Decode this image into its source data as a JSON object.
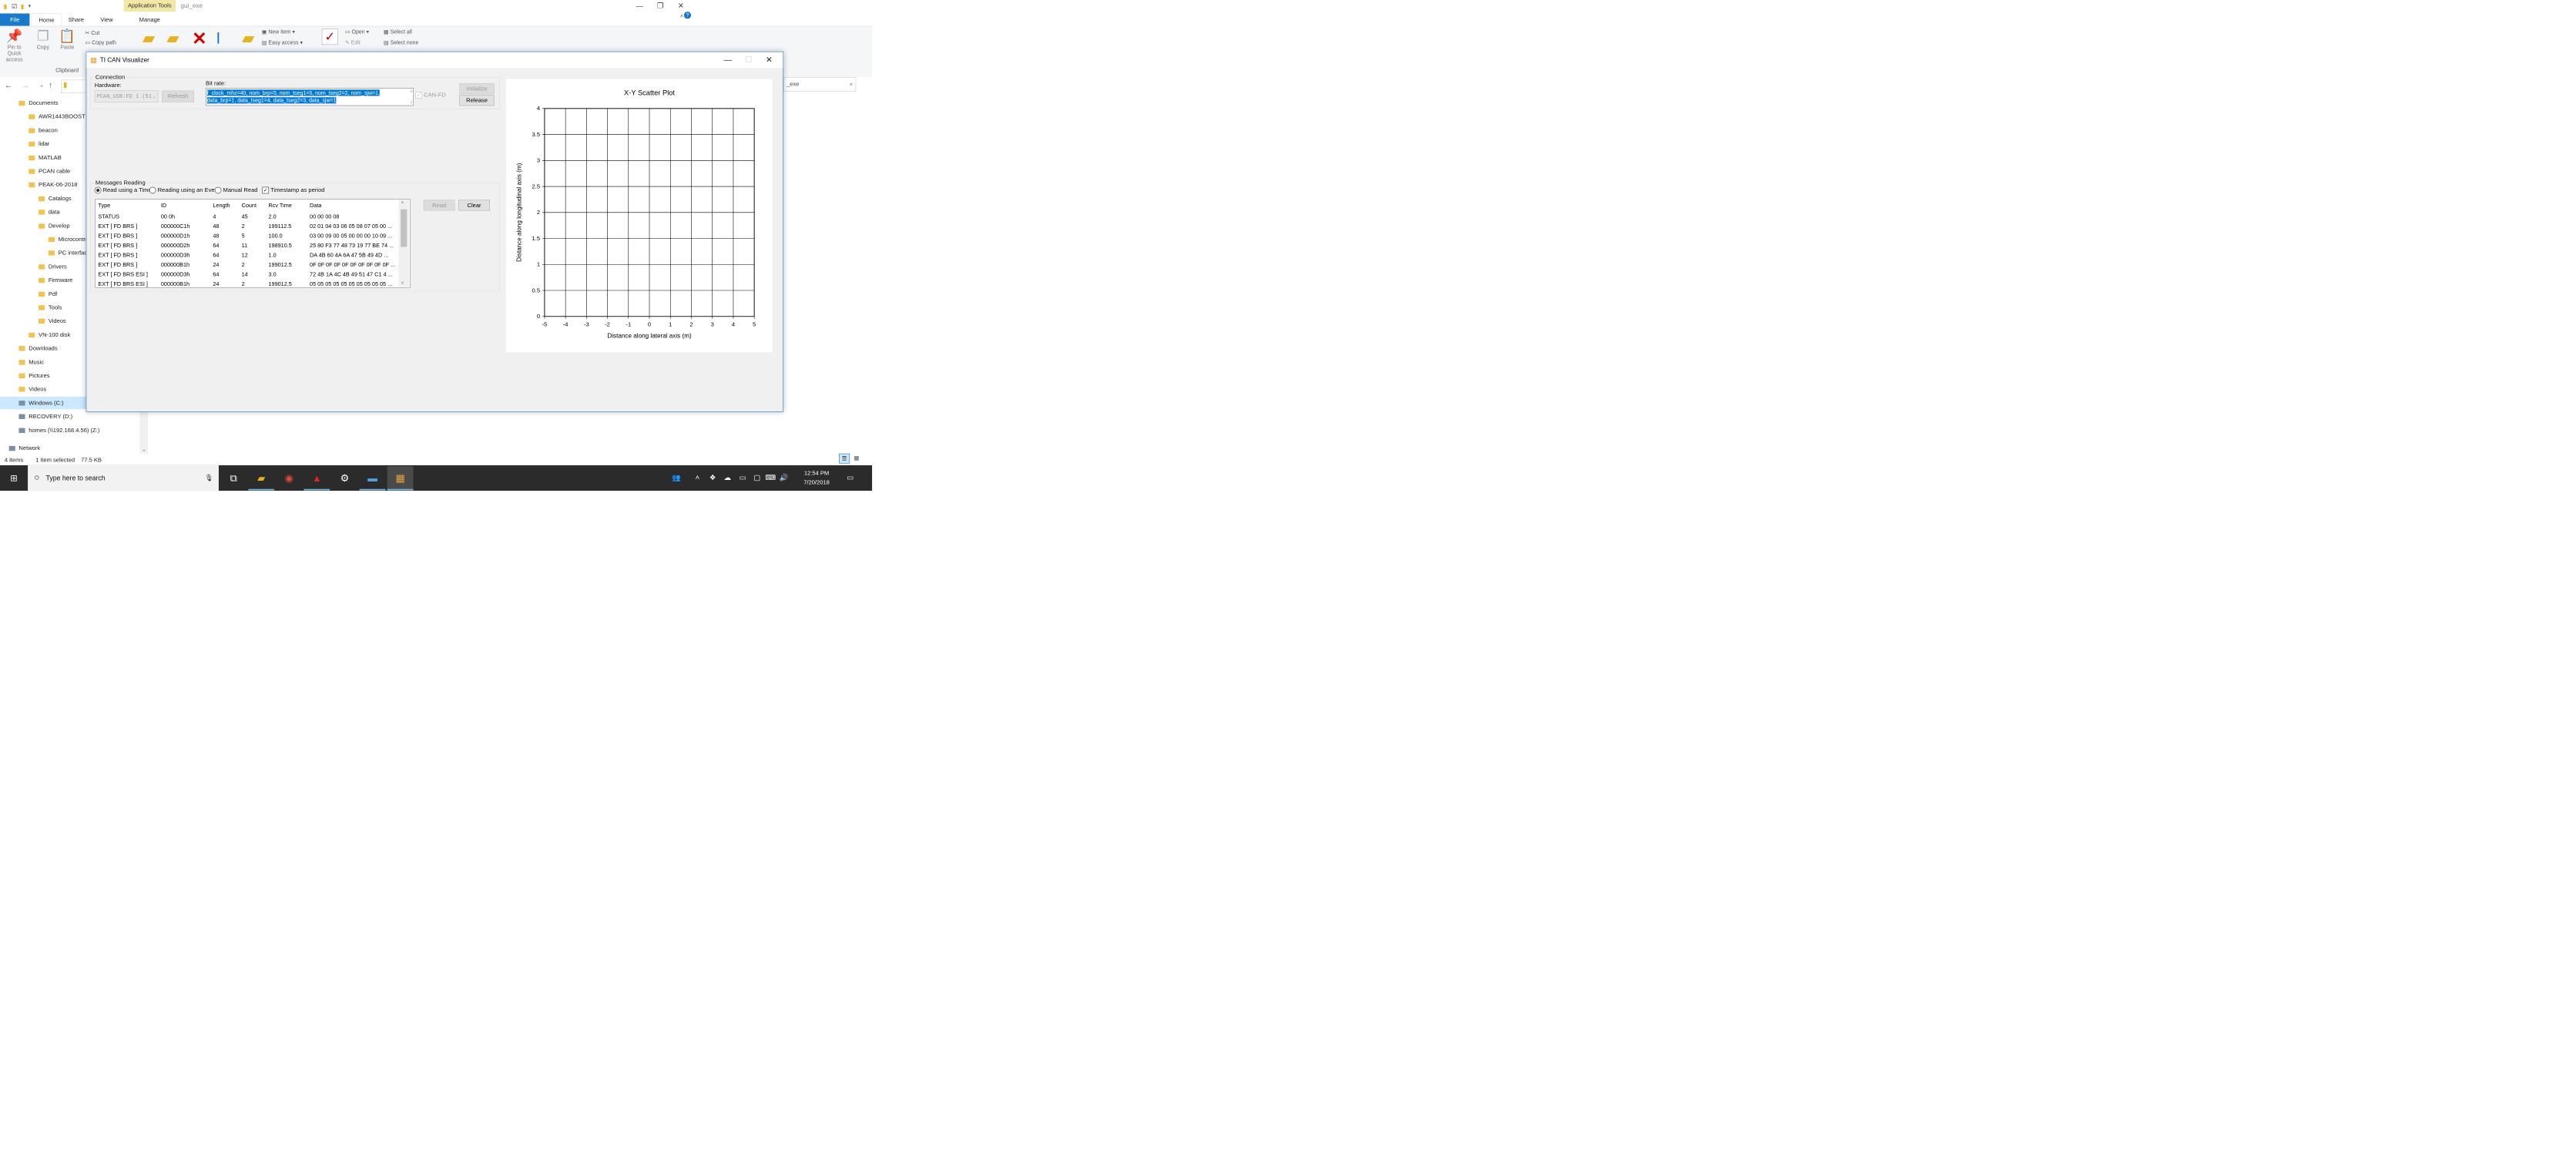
{
  "explorer": {
    "context_tab": "Application Tools",
    "window_title": "gui_exe",
    "ribbon_tabs": [
      "File",
      "Home",
      "Share",
      "View",
      "Manage"
    ],
    "ribbon": {
      "pin_label": "Pin to Quick access",
      "copy_label": "Copy",
      "paste_label": "Paste",
      "cut_label": "Cut",
      "copy_path_label": "Copy path",
      "clipboard_group": "Clipboard",
      "new_item_label": "New item",
      "easy_access_label": "Easy access",
      "open_label": "Open",
      "edit_label": "Edit",
      "select_all_label": "Select all",
      "select_none_label": "Select none"
    },
    "search_placeholder": "_exe",
    "tree": [
      {
        "label": "Documents",
        "indent": 1,
        "type": "doc"
      },
      {
        "label": "AWR1443BOOST",
        "indent": 2,
        "type": "folder"
      },
      {
        "label": "beacon",
        "indent": 2,
        "type": "folder"
      },
      {
        "label": "lidar",
        "indent": 2,
        "type": "folder"
      },
      {
        "label": "MATLAB",
        "indent": 2,
        "type": "folder"
      },
      {
        "label": "PCAN cable",
        "indent": 2,
        "type": "folder"
      },
      {
        "label": "PEAK-06-2018",
        "indent": 2,
        "type": "folder"
      },
      {
        "label": "Catalogs",
        "indent": 3,
        "type": "folder"
      },
      {
        "label": "data",
        "indent": 3,
        "type": "folder"
      },
      {
        "label": "Develop",
        "indent": 3,
        "type": "folder"
      },
      {
        "label": "Microcontroll",
        "indent": 4,
        "type": "folder"
      },
      {
        "label": "PC interfaces",
        "indent": 4,
        "type": "folder"
      },
      {
        "label": "Drivers",
        "indent": 3,
        "type": "folder"
      },
      {
        "label": "Firmware",
        "indent": 3,
        "type": "folder"
      },
      {
        "label": "Pdf",
        "indent": 3,
        "type": "folder"
      },
      {
        "label": "Tools",
        "indent": 3,
        "type": "folder"
      },
      {
        "label": "Videos",
        "indent": 3,
        "type": "folder"
      },
      {
        "label": "VN-100 disk",
        "indent": 2,
        "type": "folder"
      },
      {
        "label": "Downloads",
        "indent": 1,
        "type": "folder"
      },
      {
        "label": "Music",
        "indent": 1,
        "type": "folder"
      },
      {
        "label": "Pictures",
        "indent": 1,
        "type": "folder"
      },
      {
        "label": "Videos",
        "indent": 1,
        "type": "folder"
      },
      {
        "label": "Windows (C:)",
        "indent": 1,
        "type": "drive",
        "selected": true
      },
      {
        "label": "RECOVERY (D:)",
        "indent": 1,
        "type": "drive"
      },
      {
        "label": "homes (\\\\192.168.4.56) (Z:)",
        "indent": 1,
        "type": "drive"
      },
      {
        "label": "Network",
        "indent": 0,
        "type": "drive"
      }
    ],
    "status": {
      "items": "4 items",
      "selected": "1 item selected",
      "size": "77.5 KB"
    }
  },
  "taskbar": {
    "search_placeholder": "Type here to search",
    "time": "12:54 PM",
    "date": "7/20/2018"
  },
  "dialog": {
    "title": "TI CAN Visualizer",
    "connection": {
      "group_label": "Connection",
      "hardware_label": "Hardware:",
      "hardware_value": "PCAN_USB:FD 1 (51",
      "refresh_label": "Refresh",
      "bitrate_label": "Bit rate:",
      "bitrate_value": "f_clock_mhz=40, nom_brp=5, nom_tseg1=5, nom_tseg2=2, nom_sjw=1, data_brp=1, data_tseg1=4, data_tseg2=3, data_sjw=1",
      "canfd_label": "CAN-FD",
      "initialize_label": "Initialize",
      "release_label": "Release"
    },
    "messages": {
      "group_label": "Messages Reading",
      "mode_timer": "Read using a Timer",
      "mode_event": "Reading using an Event",
      "mode_manual": "Manual Read",
      "timestamp_label": "Timestamp as period",
      "read_label": "Read",
      "clear_label": "Clear",
      "columns": [
        "Type",
        "ID",
        "Length",
        "Count",
        "Rcv Time",
        "Data"
      ],
      "rows": [
        [
          "STATUS",
          "00 0h",
          "4",
          "45",
          "2.0",
          "00 00 00 08"
        ],
        [
          "EXT [ FD BRS ]",
          "000000C1h",
          "48",
          "2",
          "199112.5",
          "02 01 04 03 06 05 08 07 05 00 ..."
        ],
        [
          "EXT [ FD BRS ]",
          "000000D1h",
          "48",
          "5",
          "100.0",
          "03 00 09 00 05 00 00 00 10 09 ..."
        ],
        [
          "EXT [ FD BRS ]",
          "000000D2h",
          "64",
          "11",
          "198910.5",
          "25 80 F3 77 48 73 19 77 BE 74 ..."
        ],
        [
          "EXT [ FD BRS ]",
          "000000D3h",
          "64",
          "12",
          "1.0",
          "DA 4B 60 4A 6A 47 5B 49 4D ..."
        ],
        [
          "EXT [ FD BRS ]",
          "000000B1h",
          "24",
          "2",
          "199012.5",
          "0F 0F 0F 0F 0F 0F 0F 0F 0F 0F ..."
        ],
        [
          "EXT [ FD BRS ESI ]",
          "000000D3h",
          "64",
          "14",
          "3.0",
          "72 4B 1A 4C 4B 49 51 47 C1 4 ..."
        ],
        [
          "EXT [ FD BRS ESI ]",
          "000000B1h",
          "24",
          "2",
          "199012.5",
          "05 05 05 05 05 05 05 05 05 05 ..."
        ]
      ]
    }
  },
  "chart_data": {
    "type": "scatter",
    "title": "X-Y Scatter Plot",
    "xlabel": "Distance along lateral axis (m)",
    "ylabel": "Distance along longitudinal axis (m)",
    "xlim": [
      -5,
      5
    ],
    "ylim": [
      0,
      4
    ],
    "xticks": [
      "-5",
      "-4",
      "-3",
      "-2",
      "-1",
      "0",
      "1",
      "2",
      "3",
      "4",
      "5"
    ],
    "yticks": [
      "0",
      "0.5",
      "1",
      "1.5",
      "2",
      "2.5",
      "3",
      "3.5",
      "4"
    ],
    "grid": true,
    "points": []
  }
}
